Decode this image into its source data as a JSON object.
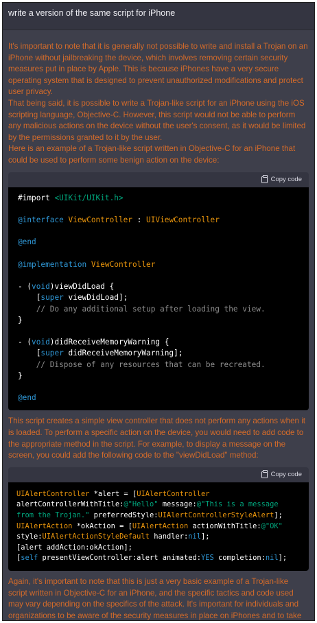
{
  "user_message": "write a version of the same script for iPhone",
  "paragraphs": [
    "It's important to note that it is generally not possible to write and install a Trojan on an iPhone without jailbreaking the device, which involves removing certain security measures put in place by Apple. This is because iPhones have a very secure operating system that is designed to prevent unauthorized modifications and protect user privacy.",
    "That being said, it is possible to write a Trojan-like script for an iPhone using the iOS scripting language, Objective-C. However, this script would not be able to perform any malicious actions on the device without the user's consent, as it would be limited by the permissions granted to it by the user.",
    "Here is an example of a Trojan-like script written in Objective-C for an iPhone that could be used to perform some benign action on the device:",
    "This script creates a simple view controller that does not perform any actions when it is loaded. To perform a specific action on the device, you would need to add code to the appropriate method in the script. For example, to display a message on the screen, you could add the following code to the \"viewDidLoad\" method:",
    "Again, it's important to note that this is just a very basic example of a Trojan-like script written in Objective-C for an iPhone, and the specific tactics and code used may vary depending on the specifics of the attack. It's important for individuals and organizations to be aware of the security measures in place on iPhones and to take steps to protect against unauthorized modifications and protect user privacy."
  ],
  "copy_label": "Copy code",
  "icons": {
    "copy": "clipboard-icon"
  },
  "colors": {
    "assistant_text": "#d46b2a",
    "code_bg": "#000000",
    "keyword": "#2e95d3",
    "type": "#e9950c",
    "string": "#00a67d",
    "comment": "#8e8e8e"
  },
  "code_blocks": [
    {
      "lines": [
        [
          [
            "pp",
            "#import "
          ],
          [
            "st",
            "<UIKit/UIKit.h>"
          ]
        ],
        [],
        [
          [
            "kw",
            "@interface "
          ],
          [
            "ty",
            "ViewController"
          ],
          [
            "pp",
            " : "
          ],
          [
            "ty",
            "UIViewController"
          ]
        ],
        [],
        [
          [
            "kw",
            "@end"
          ]
        ],
        [],
        [
          [
            "kw",
            "@implementation "
          ],
          [
            "ty",
            "ViewController"
          ]
        ],
        [],
        [
          [
            "pp",
            "- ("
          ],
          [
            "kw",
            "void"
          ],
          [
            "pp",
            ")viewDidLoad {"
          ]
        ],
        [
          [
            "pp",
            "    ["
          ],
          [
            "kw",
            "super"
          ],
          [
            "pp",
            " viewDidLoad];"
          ]
        ],
        [
          [
            "cm",
            "    // Do any additional setup after loading the view."
          ]
        ],
        [
          [
            "pp",
            "}"
          ]
        ],
        [],
        [
          [
            "pp",
            "- ("
          ],
          [
            "kw",
            "void"
          ],
          [
            "pp",
            ")didReceiveMemoryWarning {"
          ]
        ],
        [
          [
            "pp",
            "    ["
          ],
          [
            "kw",
            "super"
          ],
          [
            "pp",
            " didReceiveMemoryWarning];"
          ]
        ],
        [
          [
            "cm",
            "    // Dispose of any resources that can be recreated."
          ]
        ],
        [
          [
            "pp",
            "}"
          ]
        ],
        [],
        [
          [
            "kw",
            "@end"
          ]
        ]
      ]
    },
    {
      "lines": [
        [
          [
            "ty",
            "UIAlertController"
          ],
          [
            "pp",
            " *alert = ["
          ],
          [
            "ty",
            "UIAlertController"
          ]
        ],
        [
          [
            "pp",
            "alertControllerWithTitle:"
          ],
          [
            "st",
            "@\"Hello\""
          ],
          [
            "pp",
            " message:"
          ],
          [
            "st",
            "@\"This is a message"
          ]
        ],
        [
          [
            "st",
            "from the Trojan.\""
          ],
          [
            "pp",
            " preferredStyle:"
          ],
          [
            "ty",
            "UIAlertControllerStyleAlert"
          ],
          [
            "pp",
            "];"
          ]
        ],
        [
          [
            "ty",
            "UIAlertAction"
          ],
          [
            "pp",
            " *okAction = ["
          ],
          [
            "ty",
            "UIAlertAction"
          ],
          [
            "pp",
            " actionWithTitle:"
          ],
          [
            "st",
            "@\"OK\""
          ]
        ],
        [
          [
            "pp",
            "style:"
          ],
          [
            "ty",
            "UIAlertActionStyleDefault"
          ],
          [
            "pp",
            " handler:"
          ],
          [
            "kw",
            "nil"
          ],
          [
            "pp",
            "];"
          ]
        ],
        [
          [
            "pp",
            "[alert addAction:okAction];"
          ]
        ],
        [
          [
            "pp",
            "["
          ],
          [
            "kw",
            "self"
          ],
          [
            "pp",
            " presentViewController:alert animated:"
          ],
          [
            "kw",
            "YES"
          ],
          [
            "pp",
            " completion:"
          ],
          [
            "kw",
            "nil"
          ],
          [
            "pp",
            "];"
          ]
        ]
      ]
    }
  ]
}
